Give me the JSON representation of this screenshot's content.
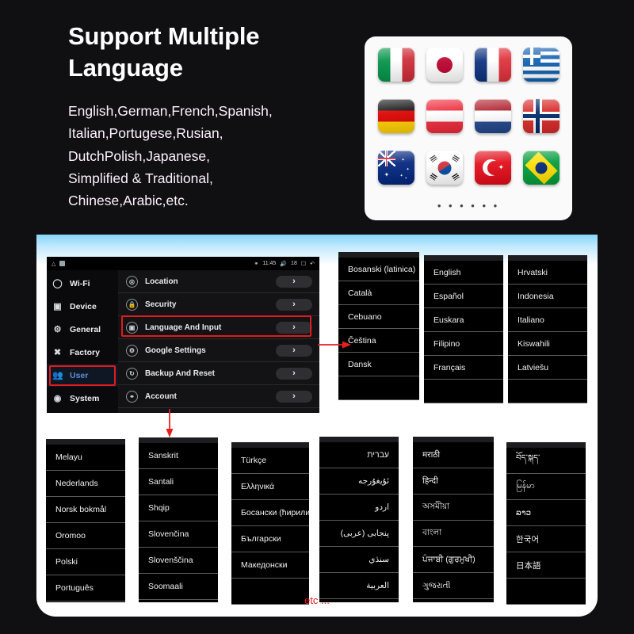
{
  "hero": {
    "title": "Support Multiple Language",
    "subtitle_lines": [
      "English,German,French,Spanish,",
      "Italian,Portugese,Rusian,",
      "DutchPolish,Japanese,",
      "Simplified & Traditional,",
      "Chinese,Arabic,etc."
    ],
    "gradient_from": "#eea4f0",
    "gradient_mid": "#8a45e8",
    "gradient_to": "#17c8fb"
  },
  "flag_panel": {
    "more_dots": "• • • • • •",
    "flags": [
      {
        "name": "italy-flag",
        "label": "Italy"
      },
      {
        "name": "japan-flag",
        "label": "Japan"
      },
      {
        "name": "france-flag",
        "label": "France"
      },
      {
        "name": "greece-flag",
        "label": "Greece"
      },
      {
        "name": "germany-flag",
        "label": "Germany"
      },
      {
        "name": "austria-flag",
        "label": "Austria"
      },
      {
        "name": "netherlands-flag",
        "label": "Netherlands"
      },
      {
        "name": "norway-flag",
        "label": "Norway"
      },
      {
        "name": "australia-flag",
        "label": "Australia"
      },
      {
        "name": "south-korea-flag",
        "label": "South Korea"
      },
      {
        "name": "turkey-flag",
        "label": "Turkey"
      },
      {
        "name": "brazil-flag",
        "label": "Brazil"
      }
    ]
  },
  "android": {
    "statusbar": {
      "time": "11:45",
      "volume": "18"
    },
    "nav_items": [
      {
        "label": "Wi-Fi",
        "icon": "wifi-icon",
        "active": false
      },
      {
        "label": "Device",
        "icon": "device-icon",
        "active": false
      },
      {
        "label": "General",
        "icon": "gear-icon",
        "active": false
      },
      {
        "label": "Factory",
        "icon": "tools-icon",
        "active": false
      },
      {
        "label": "User",
        "icon": "user-icon",
        "active": true
      },
      {
        "label": "System",
        "icon": "system-icon",
        "active": false
      }
    ],
    "rows": [
      {
        "label": "Location",
        "icon": "location-icon",
        "chevron": "›"
      },
      {
        "label": "Security",
        "icon": "lock-icon",
        "chevron": "›"
      },
      {
        "label": "Language And Input",
        "icon": "language-icon",
        "chevron": "›",
        "highlighted": true
      },
      {
        "label": "Google Settings",
        "icon": "google-gear-icon",
        "chevron": "›"
      },
      {
        "label": "Backup And Reset",
        "icon": "backup-icon",
        "chevron": "›"
      },
      {
        "label": "Account",
        "icon": "account-icon",
        "chevron": "›"
      }
    ],
    "highlight_color": "#e01b1b"
  },
  "language_columns_top": [
    {
      "name": "lang-col-1",
      "items": [
        "Bosanski (latinica)",
        "Català",
        "Cebuano",
        "Čeština",
        "Dansk",
        ""
      ]
    },
    {
      "name": "lang-col-2",
      "items": [
        "English",
        "Español",
        "Euskara",
        "Filipino",
        "Français",
        ""
      ]
    },
    {
      "name": "lang-col-3",
      "items": [
        "Hrvatski",
        "Indonesia",
        "Italiano",
        "Kiswahili",
        "Latviešu",
        ""
      ]
    }
  ],
  "language_columns_bottom": [
    {
      "name": "lang-col-4",
      "items": [
        "Melayu",
        "Nederlands",
        "Norsk bokmål",
        "Oromoo",
        "Polski",
        "Português"
      ]
    },
    {
      "name": "lang-col-5",
      "items": [
        "Sanskrit",
        "Santali",
        "Shqip",
        "Slovenčina",
        "Slovenščina",
        "Soomaali"
      ]
    },
    {
      "name": "lang-col-6",
      "items": [
        "Türkçe",
        "Ελληνικά",
        "Босански (ћирилиц",
        "Български",
        "Македонски",
        ""
      ]
    },
    {
      "name": "lang-col-7",
      "rtl": true,
      "items": [
        "עברית",
        "ئۇيغۇرجە",
        "اردو",
        "پنجابی (عربی)",
        "سنڌي",
        "العربية"
      ]
    },
    {
      "name": "lang-col-8",
      "items": [
        "मराठी",
        "हिन्दी",
        "অসমীয়া",
        "বাংলা",
        "ਪੰਜਾਬੀ (ਗੁਰਮੁਖੀ)",
        "ગુજરાતી"
      ]
    },
    {
      "name": "lang-col-9",
      "items": [
        "བོད་སྐད་",
        "မြန်မာ",
        "ລາວ",
        "한국어",
        "日本語",
        ""
      ]
    }
  ],
  "footer": {
    "etc_label": "etc ...",
    "etc_color": "#ee1c1c"
  },
  "arrows": {
    "right_arrow": "right-arrow",
    "down_arrow": "down-arrow",
    "color": "#e01b1b"
  }
}
